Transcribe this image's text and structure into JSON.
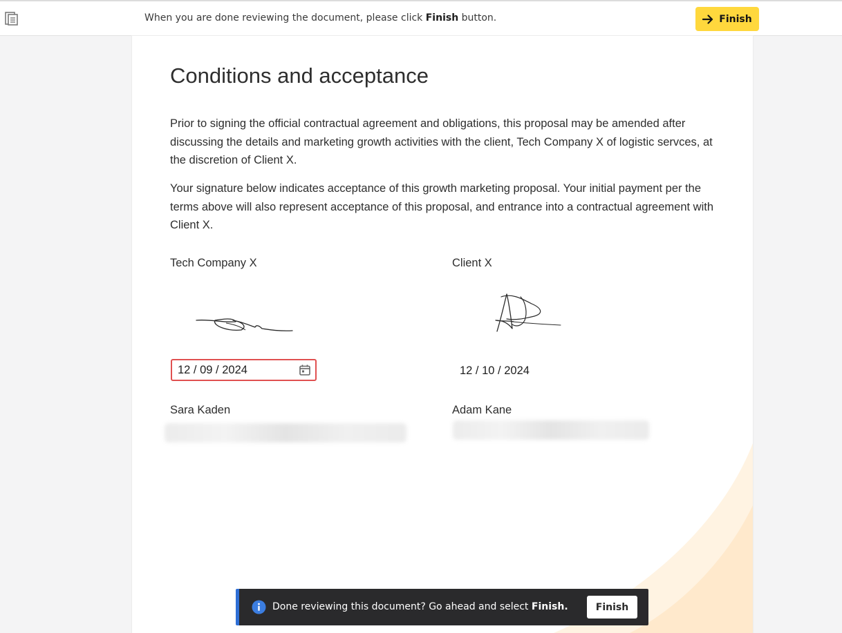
{
  "topbar": {
    "instruction_prefix": "When you are done reviewing the document, please click ",
    "instruction_bold": "Finish",
    "instruction_suffix": " button.",
    "finish_label": "Finish",
    "doc_icon": "document-icon",
    "finish_icon": "arrow-right-icon",
    "accent_color": "#ffd83d"
  },
  "document": {
    "title": "Conditions and acceptance",
    "paragraphs": [
      "Prior to signing the official contractual agreement and obligations, this proposal may be amended after discussing the details and marketing growth activities with the client, Tech Company X of logistic servces, at the discretion of Client X.",
      "Your signature below indicates acceptance of this growth marketing proposal. Your initial payment per the terms above will also represent acceptance of this proposal, and entrance into a contractual agreement with Client X."
    ],
    "parties": [
      {
        "company": "Tech Company X",
        "date": "12 / 09 / 2024",
        "date_icon": "calendar-icon",
        "signer": "Sara Kaden"
      },
      {
        "company": "Client X",
        "date": "12 / 10 / 2024",
        "signer": "Adam Kane"
      }
    ],
    "invalid_field_color": "#e05050"
  },
  "toast": {
    "message_prefix": "Done reviewing this document? Go ahead and select ",
    "message_bold": "Finish.",
    "button_label": "Finish",
    "icon": "info-icon",
    "accent_color": "#2f6fd6"
  }
}
